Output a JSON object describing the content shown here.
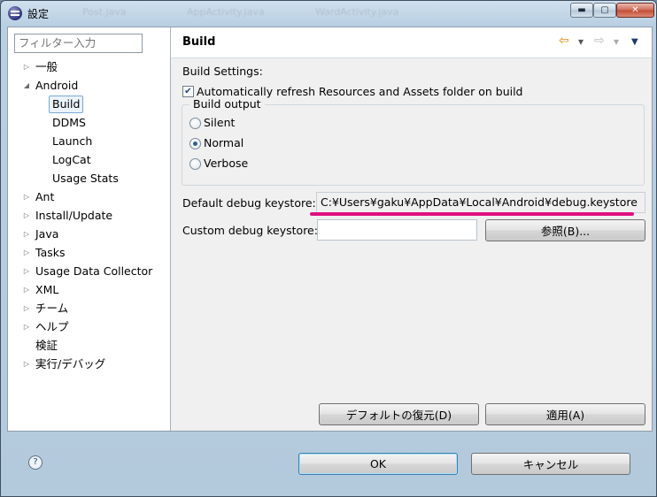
{
  "window": {
    "title": "設定",
    "background_tabs": [
      "Post.java",
      "AppActivity.java",
      "WardActivity.java"
    ],
    "controls": {
      "minimize": "▬",
      "maximize": "▢",
      "close": "✕"
    }
  },
  "sidebar": {
    "filter_placeholder": "フィルター入力",
    "items": [
      {
        "label": "一般",
        "arrow": "▷"
      },
      {
        "label": "Android",
        "arrow": "◢"
      },
      {
        "label": "Build"
      },
      {
        "label": "DDMS"
      },
      {
        "label": "Launch"
      },
      {
        "label": "LogCat"
      },
      {
        "label": "Usage Stats"
      },
      {
        "label": "Ant",
        "arrow": "▷"
      },
      {
        "label": "Install/Update",
        "arrow": "▷"
      },
      {
        "label": "Java",
        "arrow": "▷"
      },
      {
        "label": "Tasks",
        "arrow": "▷"
      },
      {
        "label": "Usage Data Collector",
        "arrow": "▷"
      },
      {
        "label": "XML",
        "arrow": "▷"
      },
      {
        "label": "チーム",
        "arrow": "▷"
      },
      {
        "label": "ヘルプ",
        "arrow": "▷"
      },
      {
        "label": "検証"
      },
      {
        "label": "実行/デバッグ",
        "arrow": "▷"
      }
    ],
    "selected": "Build"
  },
  "page": {
    "title": "Build",
    "nav": {
      "back": "⇦",
      "forward": "⇨",
      "dropdown": "▾",
      "menu": "▼"
    },
    "build_settings_label": "Build Settings:",
    "auto_refresh_checkbox": {
      "label": "Automatically refresh Resources and Assets folder on build",
      "checked": true
    },
    "build_output": {
      "title": "Build output",
      "options": [
        "Silent",
        "Normal",
        "Verbose"
      ],
      "selected": "Normal"
    },
    "default_keystore_label": "Default debug keystore:",
    "default_keystore_value": "C:¥Users¥gaku¥AppData¥Local¥Android¥debug.keystore",
    "custom_keystore_label": "Custom debug keystore:",
    "custom_keystore_value": "",
    "browse_button": "参照(B)...",
    "restore_defaults_button": "デフォルトの復元(D)",
    "apply_button": "適用(A)"
  },
  "footer": {
    "help": "?",
    "ok_button": "OK",
    "cancel_button": "キャンセル"
  },
  "colors": {
    "highlight_underline": "#e0107f",
    "selection_border": "#7aa7d6"
  }
}
